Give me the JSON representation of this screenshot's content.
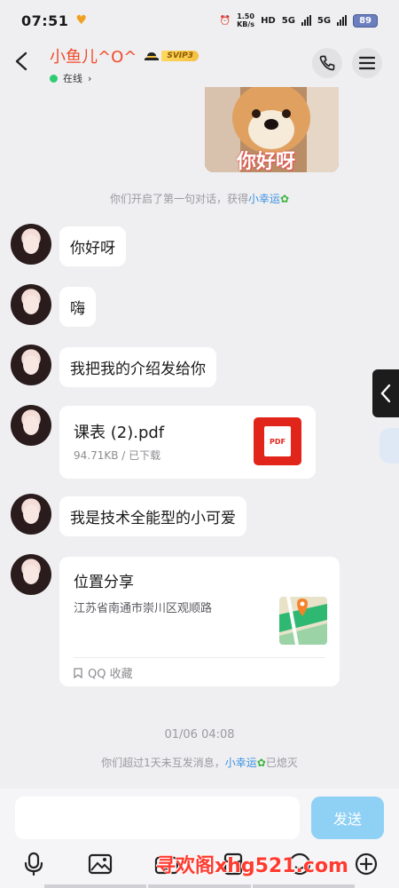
{
  "status_bar": {
    "time": "07:51",
    "speed_value": "1.50",
    "speed_unit": "KB/s",
    "hd_label": "HD",
    "net1": "5G",
    "net2": "5G",
    "battery": "89"
  },
  "header": {
    "title": "小鱼儿^O^",
    "svip_label": "SVIP3",
    "online_status": "在线"
  },
  "chat": {
    "sticker_text": "你好呀",
    "system_first_prefix": "你们开启了第一句对话，获得",
    "system_first_link": "小幸运",
    "messages": [
      {
        "text": "你好呀"
      },
      {
        "text": "嗨"
      },
      {
        "text": "我把我的介绍发给你"
      }
    ],
    "file": {
      "name": "课表 (2).pdf",
      "meta": "94.71KB / 已下载",
      "icon_label": "PDF"
    },
    "message_after_file": "我是技术全能型的小可爱",
    "location": {
      "title": "位置分享",
      "address": "江苏省南通市崇川区观顺路",
      "source": "QQ 收藏"
    },
    "timestamp": "01/06 04:08",
    "system_last_prefix": "你们超过1天未互发消息，",
    "system_last_link": "小幸运",
    "system_last_suffix": "已熄灭"
  },
  "input": {
    "placeholder": "",
    "send_label": "发送"
  },
  "watermark": "寻欢阁xhg521.com",
  "colors": {
    "title": "#f04a2a",
    "link": "#3a8fe0",
    "send_button": "#8fd0f5",
    "online_dot": "#2ecc71",
    "pdf": "#e1251b"
  }
}
